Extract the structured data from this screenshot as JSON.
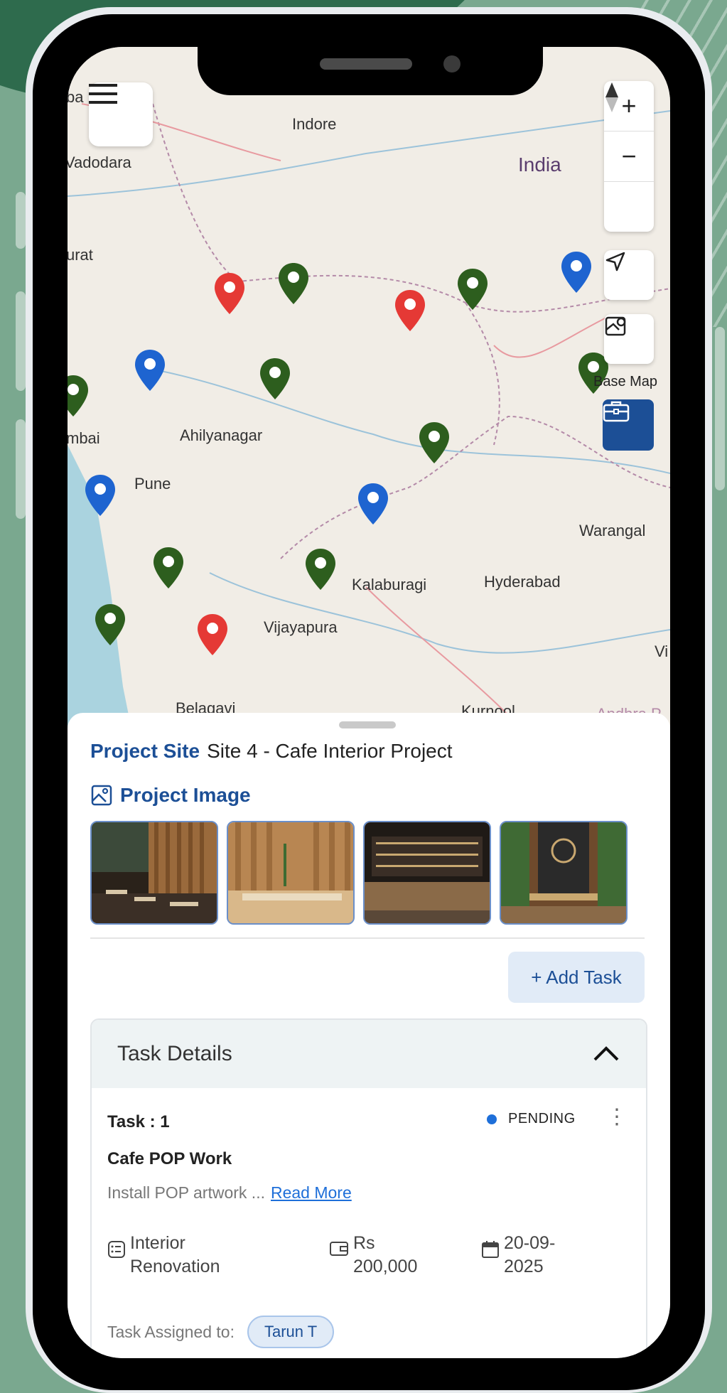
{
  "map": {
    "cities": [
      {
        "key": "indore",
        "name": "Indore"
      },
      {
        "key": "vadodara",
        "name": "Vadodara"
      },
      {
        "key": "india",
        "name": "India"
      },
      {
        "key": "surat",
        "name": "urat"
      },
      {
        "key": "mumbai",
        "name": "mbai"
      },
      {
        "key": "ahilyanagar",
        "name": "Ahilyanagar"
      },
      {
        "key": "pune",
        "name": "Pune"
      },
      {
        "key": "warangal",
        "name": "Warangal"
      },
      {
        "key": "kalaburagi",
        "name": "Kalaburagi"
      },
      {
        "key": "hyderabad",
        "name": "Hyderabad"
      },
      {
        "key": "vijayapura",
        "name": "Vijayapura"
      },
      {
        "key": "belagavi",
        "name": "Belagavi"
      },
      {
        "key": "kurnool",
        "name": "Kurnool"
      },
      {
        "key": "andhra",
        "name": "Andhra P"
      },
      {
        "key": "vi",
        "name": "Vi"
      },
      {
        "key": "ba",
        "name": "ba"
      }
    ],
    "controls": {
      "zoom_in": "+",
      "zoom_out": "−"
    },
    "base_map_label": "Base Map",
    "pin_colors": {
      "red": "#e53935",
      "green": "#2d5e1e",
      "blue": "#1e64d0"
    }
  },
  "sheet": {
    "project_site_label": "Project Site",
    "project_site_name": "Site 4 - Cafe Interior Project",
    "project_image_label": "Project Image",
    "add_task_label": "+ Add Task"
  },
  "task_details": {
    "title": "Task Details",
    "task": {
      "number": "Task : 1",
      "status": "PENDING",
      "title": "Cafe POP Work",
      "description": "Install POP artwork ...",
      "read_more": "Read More",
      "category_line1": "Interior",
      "category_line2": "Renovation",
      "amount_line1": "Rs",
      "amount_line2": "200,000",
      "date_line1": "20-09-",
      "date_line2": "2025",
      "assigned_label": "Task Assigned to:",
      "assignee": "Tarun T"
    }
  },
  "colors": {
    "primary": "#1c4f96",
    "accent_blue": "#1e6fd9"
  }
}
